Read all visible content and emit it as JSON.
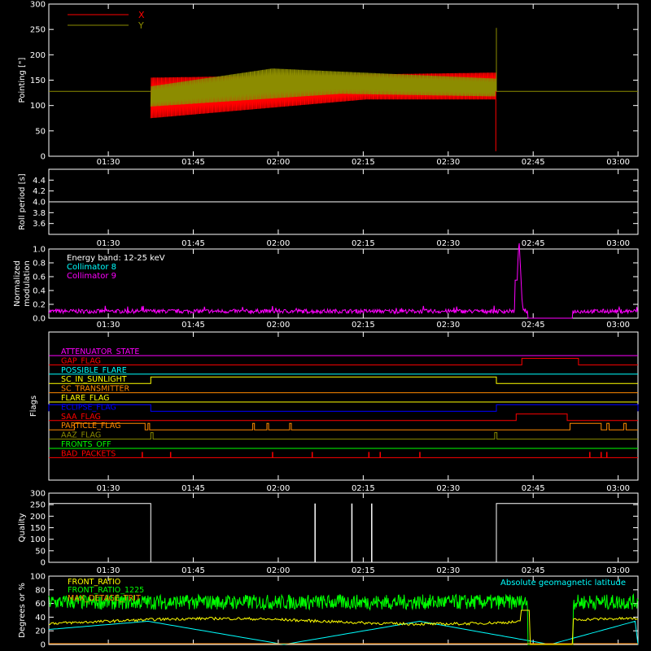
{
  "time_ticks": [
    "01:30",
    "01:45",
    "02:00",
    "02:15",
    "02:30",
    "02:45",
    "03:00"
  ],
  "time_ticks_min": [
    90,
    105,
    120,
    135,
    150,
    165,
    180
  ],
  "time_range_min": [
    79.5,
    183.5
  ],
  "chart_data": [
    {
      "type": "line",
      "ylabel": "Pointing [\"]",
      "ylim": [
        0,
        300
      ],
      "yticks": [
        0,
        50,
        100,
        150,
        200,
        250,
        300
      ],
      "legend": "top-left",
      "series": [
        {
          "name": "X",
          "color": "#ff0000",
          "band": {
            "start": 97.5,
            "end": 158.5,
            "low_start": 75,
            "low_end": 112,
            "high_start": 155,
            "high_end": 165
          }
        },
        {
          "name": "Y",
          "color": "#8c8c00",
          "band": {
            "start": 97.5,
            "end": 158.5,
            "low_start": 95,
            "low_mid": 120,
            "low_end": 115,
            "high_start": 140,
            "high_mid": 175,
            "high_end": 155
          },
          "baseline": 128,
          "spike_at": 158.5,
          "spike_value": 253
        }
      ]
    },
    {
      "type": "line",
      "ylabel": "Roll period [s]",
      "ylim": [
        3.4,
        4.6
      ],
      "yticks": [
        3.6,
        3.8,
        4.0,
        4.2,
        4.4
      ],
      "series": [
        {
          "color": "#ffffff",
          "value": 4.0
        }
      ]
    },
    {
      "type": "line",
      "ylabel": "Normalized modulation",
      "ylim": [
        0,
        1.0
      ],
      "yticks": [
        0.0,
        0.2,
        0.4,
        0.6,
        0.8,
        1.0
      ],
      "annotations": [
        "Energy band: 12-25 keV",
        "Collimator 8",
        "Collimator 9"
      ],
      "annotation_colors": [
        "#ffffff",
        "#00ffff",
        "#ff00ff"
      ],
      "series": [
        {
          "name": "Collimator 9",
          "color": "#ff00ff",
          "base": 0.1,
          "gap": [
            164,
            172
          ],
          "peak_at": 162.5,
          "peak_value": 1.0
        }
      ]
    },
    {
      "type": "table",
      "ylabel": "Flags",
      "flags": [
        {
          "name": "ATTENUATOR_STATE",
          "color": "#ff00ff",
          "high": []
        },
        {
          "name": "GAP_FLAG",
          "color": "#ff0000",
          "high": [
            [
              163,
              173
            ]
          ]
        },
        {
          "name": "POSSIBLE_FLARE",
          "color": "#00ffff",
          "high": []
        },
        {
          "name": "SC_IN_SUNLIGHT",
          "color": "#ffff00",
          "high": [
            [
              97.5,
              158.5
            ]
          ]
        },
        {
          "name": "SC_TRANSMITTER",
          "color": "#ff8800",
          "high": []
        },
        {
          "name": "FLARE_FLAG",
          "color": "#ffff00",
          "high": []
        },
        {
          "name": "ECLIPSE_FLAG",
          "color": "#0000ff",
          "high": [
            [
              79.5,
              97.5
            ],
            [
              158.5,
              183.5
            ]
          ]
        },
        {
          "name": "SAA_FLAG",
          "color": "#ff0000",
          "high": [
            [
              162,
              171
            ]
          ]
        },
        {
          "name": "PARTICLE_FLAG",
          "color": "#ff8800",
          "high": [
            [
              84,
              96.5
            ],
            [
              97,
              97.3
            ],
            [
              115.5,
              115.8
            ],
            [
              118,
              118.3
            ],
            [
              122,
              122.3
            ],
            [
              171.5,
              177
            ],
            [
              178,
              178.4
            ],
            [
              181,
              181.4
            ]
          ]
        },
        {
          "name": "AAZ_FLAG",
          "color": "#8c8c00",
          "high": [
            [
              97.5,
              97.9
            ],
            [
              158.2,
              158.6
            ]
          ]
        },
        {
          "name": "FRONTS_OFF",
          "color": "#00ff00",
          "high": []
        },
        {
          "name": "BAD_PACKETS",
          "color": "#ff0000",
          "ticks": [
            96,
            101,
            119,
            126,
            136,
            138,
            145,
            175,
            177,
            178
          ]
        }
      ]
    },
    {
      "type": "line",
      "ylabel": "Quality",
      "ylim": [
        0,
        300
      ],
      "yticks": [
        0,
        50,
        100,
        150,
        200,
        250,
        300
      ],
      "series": [
        {
          "color": "#ffffff",
          "value": 255,
          "low_segments": [
            [
              97.5,
              158.5
            ]
          ],
          "spikes": [
            126.5,
            133,
            136.5
          ]
        }
      ]
    },
    {
      "type": "line",
      "ylabel": "Degrees or %",
      "ylim": [
        0,
        100
      ],
      "yticks": [
        0,
        20,
        40,
        60,
        80,
        100
      ],
      "legend": "top-left",
      "annotations": [
        "Absolute geomagnetic latitude"
      ],
      "annotation_colors": [
        "#00ffff"
      ],
      "series": [
        {
          "name": "FRONT_RATIO",
          "color": "#ffff00",
          "base": 34,
          "gap": [
            164,
            172
          ]
        },
        {
          "name": "FRONT_RATIO_1225",
          "color": "#00ff00",
          "base": 62,
          "gap": [
            164,
            172
          ]
        },
        {
          "name": "MAX_DETAGE_TRIT",
          "color": "#ff8800",
          "base": 0
        },
        {
          "name": "Absolute geomagnetic latitude",
          "color": "#00ffff",
          "zeros": [
            121,
            168
          ],
          "peaks": [
            97,
            145,
            183
          ],
          "peak_value": 34
        }
      ]
    }
  ]
}
